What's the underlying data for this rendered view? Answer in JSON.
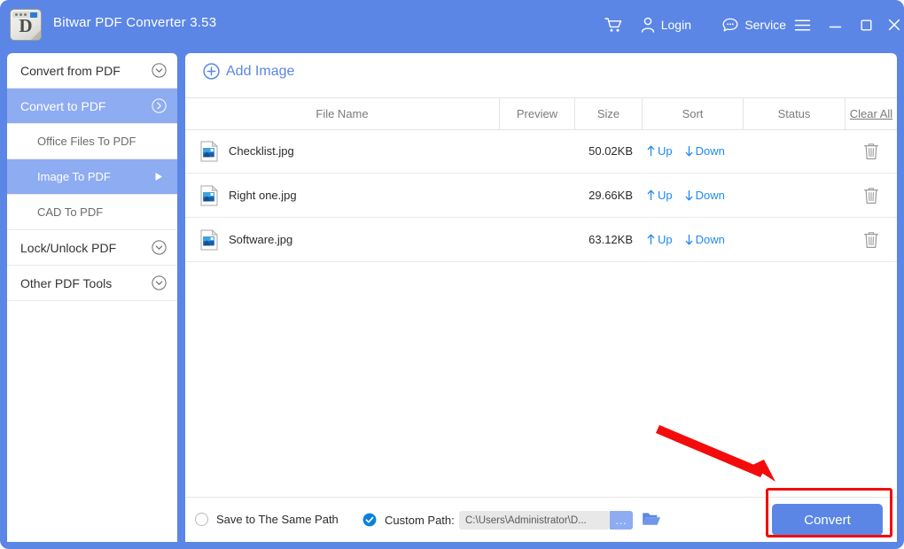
{
  "window": {
    "frame_color": "#5b86e5",
    "accent": "#5b86e5",
    "highlight": "#8eacf2",
    "link_blue": "#1e8bf0",
    "annotation_red": "#f30c0c"
  },
  "titlebar": {
    "app_name": "Bitwar PDF Converter 3.53",
    "app_icon": "pdf-converter-app-icon",
    "app_icon_letter": "D",
    "actions": [
      {
        "id": "cart",
        "icon": "shopping-cart-icon",
        "label": ""
      },
      {
        "id": "login",
        "icon": "user-icon",
        "label": "Login"
      },
      {
        "id": "service",
        "icon": "chat-bubble-icon",
        "label": "Service"
      },
      {
        "id": "menu",
        "icon": "hamburger-menu-icon",
        "label": ""
      },
      {
        "id": "minimize",
        "icon": "minimize-icon",
        "label": ""
      },
      {
        "id": "maximize",
        "icon": "maximize-icon",
        "label": ""
      },
      {
        "id": "close",
        "icon": "close-icon",
        "label": ""
      }
    ]
  },
  "sidebar": {
    "items": [
      {
        "label": "Convert from PDF",
        "type": "group",
        "active": false,
        "icon": "chevron-down-circle-icon"
      },
      {
        "label": "Convert to PDF",
        "type": "group",
        "active": true,
        "icon": "chevron-right-circle-icon"
      },
      {
        "label": "Office Files To PDF",
        "type": "sub",
        "active": false,
        "icon": ""
      },
      {
        "label": "Image To PDF",
        "type": "sub",
        "active": true,
        "icon": "arrow-right-icon"
      },
      {
        "label": "CAD To PDF",
        "type": "sub",
        "active": false,
        "icon": ""
      },
      {
        "label": "Lock/Unlock PDF",
        "type": "group",
        "active": false,
        "icon": "chevron-down-circle-icon"
      },
      {
        "label": "Other PDF Tools",
        "type": "group",
        "active": false,
        "icon": "chevron-down-circle-icon"
      }
    ]
  },
  "main": {
    "add_button": {
      "label": "Add Image",
      "icon": "plus-circle-icon"
    },
    "table": {
      "headers": [
        {
          "label": "File Name",
          "key": "name"
        },
        {
          "label": "Preview",
          "key": "preview"
        },
        {
          "label": "Size",
          "key": "size"
        },
        {
          "label": "Sort",
          "key": "sort"
        },
        {
          "label": "Status",
          "key": "status"
        },
        {
          "label": "Clear All",
          "key": "clear"
        }
      ],
      "sort_up_label": "Up",
      "sort_down_label": "Down",
      "delete_icon": "trash-icon",
      "file_icon": "image-file-icon",
      "rows": [
        {
          "name": "Checklist.jpg",
          "size": "50.02KB",
          "status": ""
        },
        {
          "name": "Right one.jpg",
          "size": "29.66KB",
          "status": ""
        },
        {
          "name": "Software.jpg",
          "size": "63.12KB",
          "status": ""
        }
      ]
    }
  },
  "bottom": {
    "same_path": {
      "label": "Save to The Same Path",
      "selected": false
    },
    "custom_path": {
      "label": "Custom Path:",
      "selected": true
    },
    "path_value": "C:\\Users\\Administrator\\D...",
    "browse_dots_label": "...",
    "folder_icon": "folder-open-icon",
    "convert_label": "Convert"
  },
  "annotations": {
    "arrow": "red-arrow-pointing-to-convert",
    "box": "red-highlight-box-around-convert"
  }
}
